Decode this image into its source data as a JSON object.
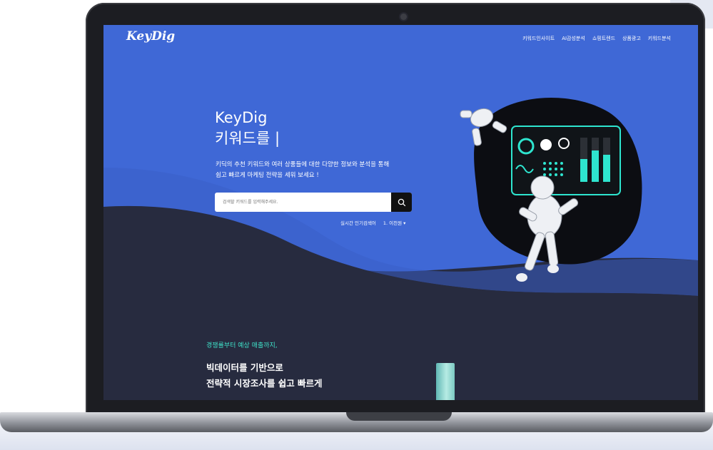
{
  "site": {
    "logo": "KeyDig",
    "nav": [
      "키워드인사이트",
      "AI감성분석",
      "쇼핑트렌드",
      "상품광고",
      "키워드분석"
    ]
  },
  "hero": {
    "title": "KeyDig",
    "subtitle": "키워드를 |",
    "description_line1": "키딕의 추천 키워드와 여러 상품들에 대한 다양한 정보와 분석을 통해",
    "description_line2": "쉽고 빠르게 마케팅 전략을 세워 보세요 !",
    "search": {
      "placeholder": "검색할 키워드를 입력해주세요.",
      "icon": "search-icon"
    },
    "realtime_label": "실시간 인기검색어",
    "realtime_top": "1. 이천원 ▾"
  },
  "section2": {
    "subtitle": "경쟁률부터 예상 매출까지,",
    "heading_line1": "빅데이터를 기반으로",
    "heading_line2": "전략적 시장조사를 쉽고 빠르게"
  },
  "colors": {
    "hero_blue": "#3f68d6",
    "dark_bg": "#272b3f",
    "accent_teal": "#3fe0c8"
  }
}
